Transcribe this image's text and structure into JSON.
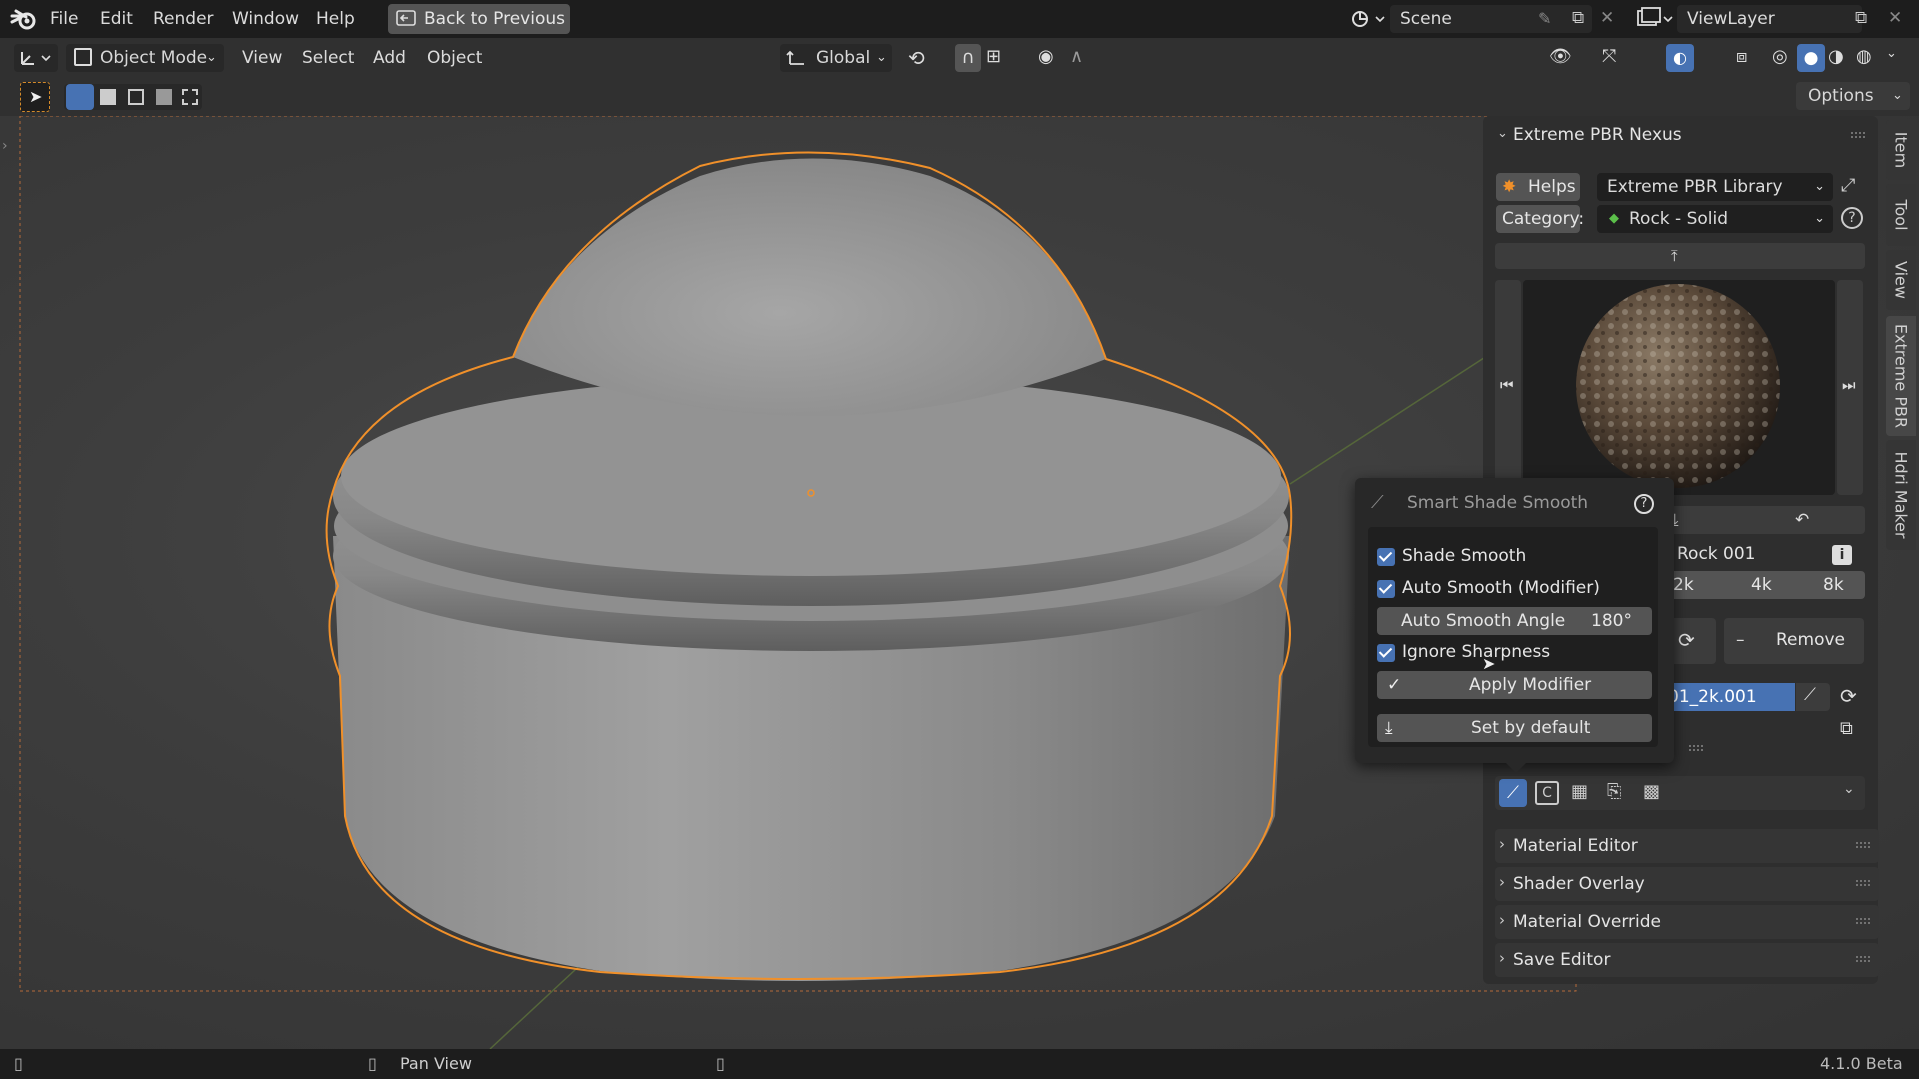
{
  "menu": {
    "file": "File",
    "edit": "Edit",
    "render": "Render",
    "window": "Window",
    "help": "Help",
    "back_to_previous": "Back to Previous",
    "scene": "Scene",
    "view_layer": "ViewLayer"
  },
  "header": {
    "mode": "Object Mode",
    "view": "View",
    "select": "Select",
    "add": "Add",
    "object": "Object",
    "orientation": "Global",
    "options": "Options"
  },
  "npanel": {
    "title": "Extreme PBR Nexus",
    "helps": "Helps",
    "library": "Extreme PBR Library",
    "category_label": "Category:",
    "category_value": "Rock - Solid",
    "material_name": "Rock 001",
    "res_2k": "2k",
    "res_4k": "4k",
    "res_8k": "8k",
    "remove": "Remove",
    "material_slot": "01_2k.001",
    "subpanels": [
      "Material Editor",
      "Shader Overlay",
      "Material Override",
      "Save Editor"
    ],
    "tabs": [
      "Item",
      "Tool",
      "View",
      "Extreme PBR",
      "Hdri Maker"
    ]
  },
  "popup": {
    "title": "Smart Shade Smooth",
    "shade_smooth": "Shade Smooth",
    "auto_smooth": "Auto Smooth (Modifier)",
    "auto_smooth_angle_label": "Auto Smooth Angle",
    "auto_smooth_angle_value": "180°",
    "ignore_sharpness": "Ignore Sharpness",
    "apply_modifier": "Apply Modifier",
    "set_by_default": "Set by default",
    "checked": {
      "shade_smooth": true,
      "auto_smooth": true,
      "ignore_sharpness": true
    }
  },
  "status": {
    "pan_view": "Pan View",
    "version": "4.1.0 Beta"
  },
  "colors": {
    "accent_blue": "#4772b3",
    "selection_orange": "#f0902a",
    "panel_bg": "#2e2e2e",
    "menu_bg": "#1d1d1d"
  }
}
